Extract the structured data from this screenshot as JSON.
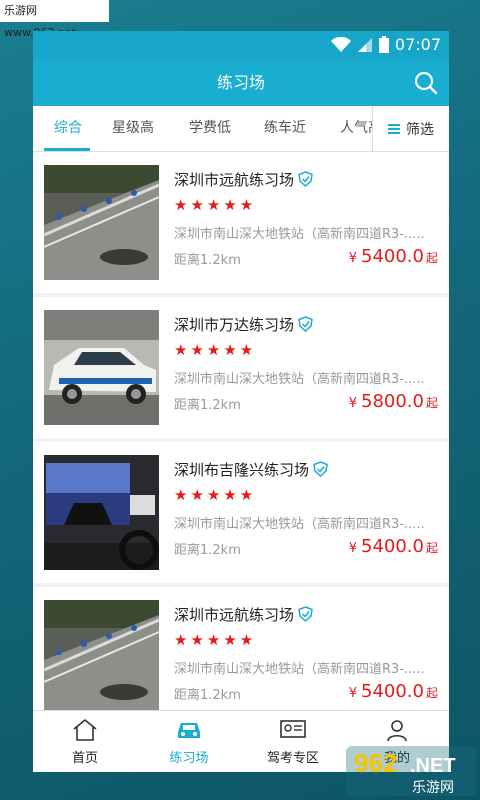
{
  "watermark_top": "乐游网 www.962.net",
  "watermark_logo": "962.NET 乐游网",
  "status": {
    "time": "07:07"
  },
  "appbar": {
    "title": "练习场"
  },
  "filters": {
    "tabs": [
      "综合",
      "星级高",
      "学费低",
      "练车近",
      "人气高"
    ],
    "active": 0,
    "filter_label": "筛选"
  },
  "cards": [
    {
      "name": "深圳市远航练习场",
      "rating": 5,
      "address": "深圳市南山深大地铁站（高新南四道R3-.....",
      "distance": "距离1.2km",
      "currency": "¥",
      "price": "5400.0",
      "price_suffix": "起",
      "image": "road"
    },
    {
      "name": "深圳市万达练习场",
      "rating": 5,
      "address": "深圳市南山深大地铁站（高新南四道R3-.....",
      "distance": "距离1.2km",
      "currency": "¥",
      "price": "5800.0",
      "price_suffix": "起",
      "image": "car"
    },
    {
      "name": "深圳布吉隆兴练习场",
      "rating": 5,
      "address": "深圳市南山深大地铁站（高新南四道R3-.....",
      "distance": "距离1.2km",
      "currency": "¥",
      "price": "5400.0",
      "price_suffix": "起",
      "image": "simulator"
    },
    {
      "name": "深圳市远航练习场",
      "rating": 5,
      "address": "深圳市南山深大地铁站（高新南四道R3-.....",
      "distance": "距离1.2km",
      "currency": "¥",
      "price": "5400.0",
      "price_suffix": "起",
      "image": "road"
    }
  ],
  "bottom_nav": {
    "items": [
      "首页",
      "练习场",
      "驾考专区",
      "我的"
    ],
    "active": 1
  },
  "colors": {
    "accent": "#19aed0",
    "price": "#e41b1b"
  }
}
